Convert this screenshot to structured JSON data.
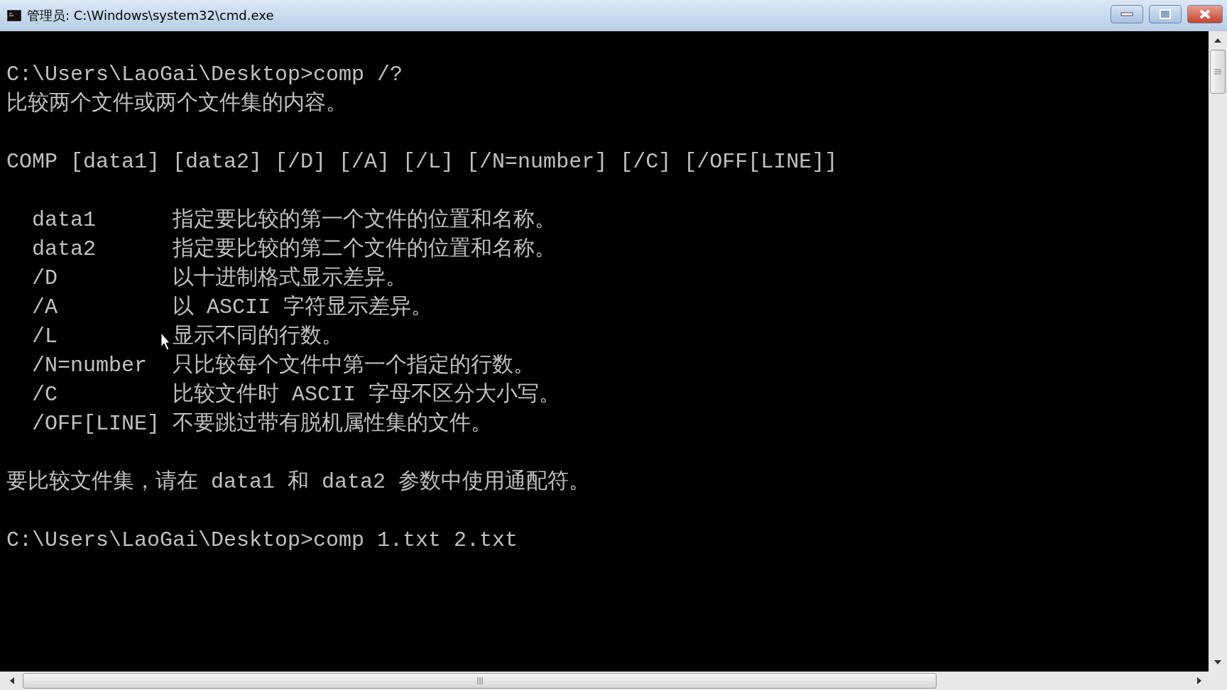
{
  "window": {
    "title": "管理员: C:\\Windows\\system32\\cmd.exe"
  },
  "console": {
    "lines": [
      {
        "kind": "gap"
      },
      {
        "kind": "text",
        "text": "C:\\Users\\LaoGai\\Desktop>comp /?"
      },
      {
        "kind": "text",
        "text": "比较两个文件或两个文件集的内容。"
      },
      {
        "kind": "gap"
      },
      {
        "kind": "text",
        "text": "COMP [data1] [data2] [/D] [/A] [/L] [/N=number] [/C] [/OFF[LINE]]"
      },
      {
        "kind": "gap"
      },
      {
        "kind": "option",
        "switch": "data1",
        "desc": "指定要比较的第一个文件的位置和名称。"
      },
      {
        "kind": "option",
        "switch": "data2",
        "desc": "指定要比较的第二个文件的位置和名称。"
      },
      {
        "kind": "option",
        "switch": "/D",
        "desc": "以十进制格式显示差异。"
      },
      {
        "kind": "option",
        "switch": "/A",
        "desc": "以 ASCII 字符显示差异。"
      },
      {
        "kind": "option",
        "switch": "/L",
        "desc": "显示不同的行数。"
      },
      {
        "kind": "option",
        "switch": "/N=number",
        "desc": "只比较每个文件中第一个指定的行数。"
      },
      {
        "kind": "option",
        "switch": "/C",
        "desc": "比较文件时 ASCII 字母不区分大小写。"
      },
      {
        "kind": "option",
        "switch": "/OFF[LINE]",
        "desc": "不要跳过带有脱机属性集的文件。"
      },
      {
        "kind": "gap"
      },
      {
        "kind": "text",
        "text": "要比较文件集，请在 data1 和 data2 参数中使用通配符。"
      },
      {
        "kind": "gap"
      },
      {
        "kind": "text",
        "text": "C:\\Users\\LaoGai\\Desktop>comp 1.txt 2.txt"
      }
    ]
  }
}
